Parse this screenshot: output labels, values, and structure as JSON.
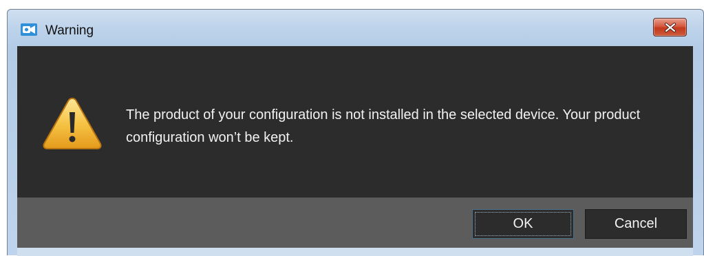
{
  "window": {
    "title": "Warning",
    "app_icon": "camera-app-icon",
    "close_icon": "close-icon"
  },
  "dialog": {
    "icon": "warning-triangle-icon",
    "message": "The product of your configuration is not installed in the selected device. Your product configuration won’t be kept."
  },
  "buttons": {
    "ok_label": "OK",
    "cancel_label": "Cancel"
  },
  "colors": {
    "close_button": "#c9472b",
    "client_background": "#2c2c2c",
    "footer_background": "#5c5c5c",
    "warning_icon": "#f2b53a"
  }
}
